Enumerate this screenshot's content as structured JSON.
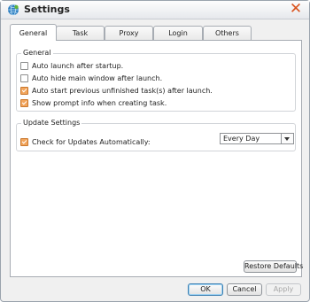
{
  "window": {
    "title": "Settings",
    "icon": "globe-icon",
    "close_icon": "close-icon"
  },
  "tabs": [
    {
      "label": "General",
      "active": true
    },
    {
      "label": "Task",
      "active": false
    },
    {
      "label": "Proxy",
      "active": false
    },
    {
      "label": "Login",
      "active": false
    },
    {
      "label": "Others",
      "active": false
    }
  ],
  "general_group": {
    "title": "General",
    "options": [
      {
        "label": "Auto launch after startup.",
        "checked": false
      },
      {
        "label": "Auto hide main window after launch.",
        "checked": false
      },
      {
        "label": "Auto start previous unfinished task(s) after launch.",
        "checked": true
      },
      {
        "label": "Show prompt info when creating task.",
        "checked": true
      }
    ]
  },
  "update_group": {
    "title": "Update Settings",
    "check_label": "Check for Updates Automatically:",
    "checked": true,
    "frequency_value": "Every Day"
  },
  "buttons": {
    "restore_defaults": "Restore Defaults",
    "ok": "OK",
    "cancel": "Cancel",
    "apply": "Apply"
  },
  "colors": {
    "accent_checkbox": "#f2a55c",
    "close_x": "#d9531e"
  }
}
